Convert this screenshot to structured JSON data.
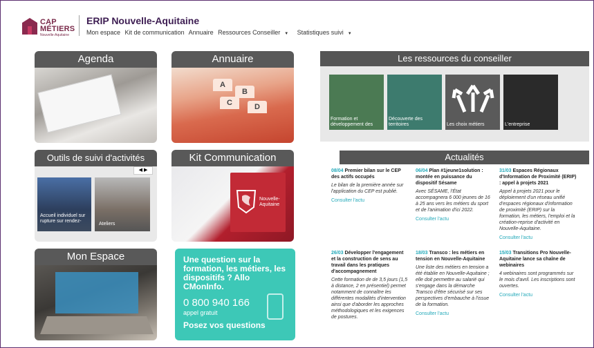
{
  "header": {
    "logo": {
      "line1": "CAP",
      "line2": "MÉTIERS",
      "sub": "Nouvelle-Aquitaine"
    },
    "site_title": "ERIP Nouvelle-Aquitaine",
    "nav": [
      "Mon espace",
      "Kit de communication",
      "Annuaire",
      "Ressources Conseiller",
      "Statistiques suivi"
    ]
  },
  "tiles": {
    "agenda": "Agenda",
    "annuaire": "Annuaire",
    "outils": "Outils de suivi d'activités",
    "outils_captions": [
      "Accueil individuel sur rupture sur rendez-",
      "Ateliers"
    ],
    "kit": "Kit Communication",
    "kit_flag_text": [
      "Nouvelle-",
      "Aquitaine"
    ],
    "espace": "Mon Espace",
    "annuaire_letters": [
      "A",
      "B",
      "C",
      "D"
    ]
  },
  "cmon": {
    "question": "Une question sur la formation, les métiers, les dispositifs ? Allo CMonInfo.",
    "phone": "0 800 940 166",
    "free": "appel gratuit",
    "ask": "Posez vos questions"
  },
  "ressources": {
    "title": "Les ressources du conseiller",
    "items": [
      {
        "label": "Formation et développement des",
        "color": "#4b7a53"
      },
      {
        "label": "Découverte des territoires",
        "color": "#3d7b6e"
      },
      {
        "label": "Les choix métiers",
        "color": "#5a5a5a"
      },
      {
        "label": "L'entreprise",
        "color": "#2a2a2a"
      }
    ]
  },
  "actualites": {
    "title": "Actualités",
    "link": "Consulter l'actu",
    "news": [
      {
        "date": "08/04",
        "title": "Premier bilan sur le CEP des actifs occupés",
        "body": "Le bilan de la première année sur l'application du CEP est publié."
      },
      {
        "date": "06/04",
        "title": "Plan #1jeune1solution : montée en puissance du dispositif Sésame",
        "body": "Avec SÉSAME, l'État accompagnera 6 000 jeunes de 16 à 25 ans vers les métiers du sport et de l'animation d'ici 2022."
      },
      {
        "date": "31/03",
        "title": "Espaces Régionaux d'Information de Proximité (ERIP) : appel à projets 2021",
        "body": "Appel à projets 2021 pour le déploiement d'un réseau unifié d'espaces régionaux d'information de proximité (ERIP) sur la formation, les métiers, l'emploi et la création-reprise d'activité en Nouvelle-Aquitaine."
      },
      {
        "date": "26/03",
        "title": "Développer l'engagement et la construction de sens au travail dans les pratiques d'accompagnement",
        "body": "Cette formation de de 3,5 jours (1,5 à distance, 2 en présentiel) permet notamment de connaître les différentes modalités d'intervention ainsi que d'aborder les approches méthodologiques et les exigences de postures."
      },
      {
        "date": "18/03",
        "title": "Transco : les métiers en tension en Nouvelle-Aquitaine",
        "body": "Une liste des métiers en tension a été établie en Nouvelle-Aquitaine ; elle doit permettre au salarié qui s'engage dans la démarche Transco d'être sécurisé sur ses perspectives d'embauche à l'issue de la formation."
      },
      {
        "date": "15/03",
        "title": "Transitions Pro Nouvelle-Aquitaine lance sa chaîne de webinaires",
        "body": "4 webinaires sont programmés sur le mois d'avril. Les inscriptions sont ouvertes."
      }
    ]
  }
}
